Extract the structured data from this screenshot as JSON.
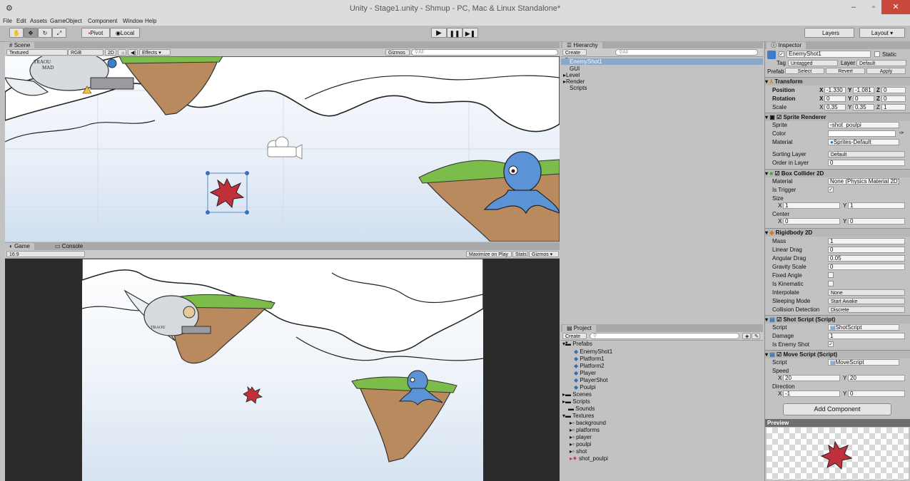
{
  "window": {
    "title": "Unity - Stage1.unity - Shmup - PC, Mac & Linux Standalone*",
    "min": "–",
    "max": "▫",
    "close": "✕"
  },
  "menu": [
    "File",
    "Edit",
    "Assets",
    "GameObject",
    "Component",
    "Window",
    "Help"
  ],
  "toolbar": {
    "pivot": "Pivot",
    "local": "Local",
    "layers": "Layers",
    "layout": "Layout"
  },
  "scene": {
    "tab": "Scene",
    "textured": "Textured",
    "rgb": "RGB",
    "mode2d": "2D",
    "effects": "Effects",
    "gizmos": "Gizmos",
    "search": "All"
  },
  "scene_art": {
    "ship_text_1": "TRAOU",
    "ship_text_2": "MAD"
  },
  "game": {
    "tab": "Game",
    "console_tab": "Console",
    "aspect": "16:9",
    "maximize": "Maximize on Play",
    "stats": "Stats",
    "gizmos": "Gizmos",
    "ship_text": "TRAOU"
  },
  "hierarchy": {
    "tab": "Hierarchy",
    "create": "Create",
    "search": "All",
    "items": [
      "EnemyShot1",
      "GUI",
      "Level",
      "Render",
      "Scripts"
    ]
  },
  "project": {
    "tab": "Project",
    "create": "Create",
    "items": [
      {
        "label": "Prefabs",
        "depth": 0
      },
      {
        "label": "EnemyShot1",
        "depth": 1
      },
      {
        "label": "Platform1",
        "depth": 1
      },
      {
        "label": "Platform2",
        "depth": 1
      },
      {
        "label": "Player",
        "depth": 1
      },
      {
        "label": "PlayerShot",
        "depth": 1
      },
      {
        "label": "Poulpi",
        "depth": 1
      },
      {
        "label": "Scenes",
        "depth": 0
      },
      {
        "label": "Scripts",
        "depth": 0
      },
      {
        "label": "Sounds",
        "depth": 0
      },
      {
        "label": "Textures",
        "depth": 0
      },
      {
        "label": "background",
        "depth": 1
      },
      {
        "label": "platforms",
        "depth": 1
      },
      {
        "label": "player",
        "depth": 1
      },
      {
        "label": "poulpi",
        "depth": 1
      },
      {
        "label": "shot",
        "depth": 1
      },
      {
        "label": "shot_poulpi",
        "depth": 1
      }
    ]
  },
  "inspector": {
    "tab": "Inspector",
    "object_name": "EnemyShot1",
    "static": "Static",
    "tag_label": "Tag",
    "tag_value": "Untagged",
    "layer_label": "Layer",
    "layer_value": "Default",
    "prefab": "Prefab",
    "select": "Select",
    "revert": "Revert",
    "apply": "Apply",
    "transform": {
      "title": "Transform",
      "position_label": "Position",
      "pos_x": "-1.330",
      "pos_y": "-1.081",
      "pos_z": "0",
      "rotation_label": "Rotation",
      "rot_x": "0",
      "rot_y": "0",
      "rot_z": "0",
      "scale_label": "Scale",
      "scale_x": "0.35",
      "scale_y": "0.35",
      "scale_z": "1"
    },
    "sprite_renderer": {
      "title": "Sprite Renderer",
      "sprite_label": "Sprite",
      "sprite_value": "shot_poulpi",
      "color_label": "Color",
      "material_label": "Material",
      "material_value": "Sprites-Default",
      "sorting_label": "Sorting Layer",
      "sorting_value": "Default",
      "order_label": "Order in Layer",
      "order_value": "0"
    },
    "box_collider": {
      "title": "Box Collider 2D",
      "material_label": "Material",
      "material_value": "None (Physics Material 2D)",
      "trigger_label": "Is Trigger",
      "size_label": "Size",
      "size_x": "1",
      "size_y": "1",
      "center_label": "Center",
      "center_x": "0",
      "center_y": "0"
    },
    "rigidbody": {
      "title": "Rigidbody 2D",
      "mass_label": "Mass",
      "mass": "1",
      "linear_label": "Linear Drag",
      "linear": "0",
      "angular_label": "Angular Drag",
      "angular": "0.05",
      "gravity_label": "Gravity Scale",
      "gravity": "0",
      "fixed_label": "Fixed Angle",
      "kinematic_label": "Is Kinematic",
      "interpolate_label": "Interpolate",
      "interpolate": "None",
      "sleeping_label": "Sleeping Mode",
      "sleeping": "Start Awake",
      "collision_label": "Collision Detection",
      "collision": "Discrete"
    },
    "shot_script": {
      "title": "Shot Script (Script)",
      "script_label": "Script",
      "script_value": "ShotScript",
      "damage_label": "Damage",
      "damage": "1",
      "enemy_label": "Is Enemy Shot"
    },
    "move_script": {
      "title": "Move Script (Script)",
      "script_label": "Script",
      "script_value": "MoveScript",
      "speed_label": "Speed",
      "speed_x": "20",
      "speed_y": "20",
      "direction_label": "Direction",
      "dir_x": "-1",
      "dir_y": "0"
    },
    "add_component": "Add Component",
    "preview": "Preview"
  },
  "axis": {
    "x": "X",
    "y": "Y",
    "z": "Z"
  },
  "colors": {
    "accent": "#3d7cc9",
    "selection": "#8aa7c8",
    "close": "#c9483c"
  }
}
